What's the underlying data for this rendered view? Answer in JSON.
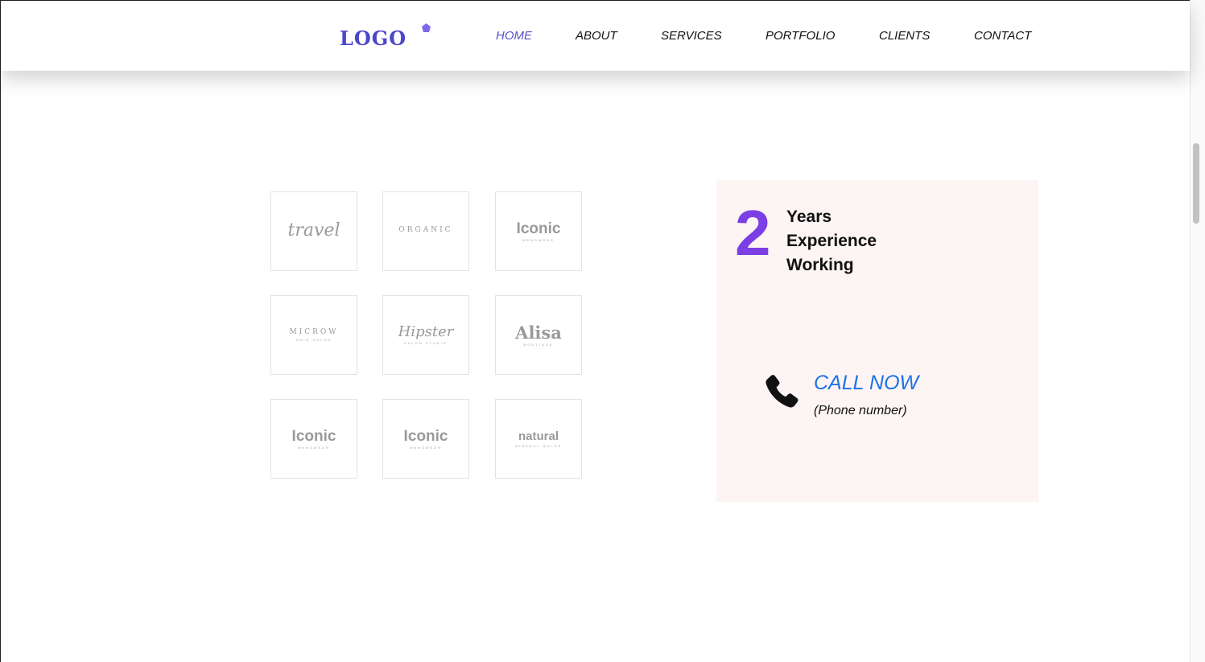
{
  "header": {
    "logo_text": "LOGO",
    "nav": [
      {
        "label": "HOME",
        "active": true
      },
      {
        "label": "ABOUT",
        "active": false
      },
      {
        "label": "SERVICES",
        "active": false
      },
      {
        "label": "PORTFOLIO",
        "active": false
      },
      {
        "label": "CLIENTS",
        "active": false
      },
      {
        "label": "CONTACT",
        "active": false
      }
    ]
  },
  "clients": {
    "logos": [
      {
        "main": "travel",
        "sub": ""
      },
      {
        "main": "ORGANIC",
        "sub": ""
      },
      {
        "main": "Iconic",
        "sub": "MENSWEAR"
      },
      {
        "main": "MICROW",
        "sub": "HAIR SALON"
      },
      {
        "main": "Hipster",
        "sub": "SALON STUDIO"
      },
      {
        "main": "Alisa",
        "sub": "BOUTIQUE"
      },
      {
        "main": "Iconic",
        "sub": "MENSWEAR"
      },
      {
        "main": "Iconic",
        "sub": "MENSWEAR"
      },
      {
        "main": "natural",
        "sub": "MINERAL WATER"
      }
    ]
  },
  "experience": {
    "number": "2",
    "lines": [
      "Years",
      "Experience",
      "Working"
    ]
  },
  "call": {
    "label": "CALL NOW",
    "phone": "(Phone number)",
    "icon": "phone-icon"
  },
  "colors": {
    "accent": "#7b3fe4",
    "nav_active": "#5a4fcf",
    "logo": "#4b47c9",
    "call_link": "#1d72e8",
    "card_bg": "#fdf4f4"
  }
}
